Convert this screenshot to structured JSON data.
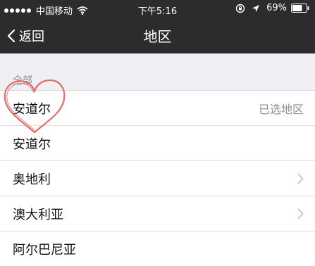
{
  "status_bar": {
    "carrier": "中国移动",
    "time": "下午5:16",
    "battery": "69%",
    "icons": [
      "signal-dots",
      "wifi-icon",
      "lock-rotation-icon",
      "location-arrow-icon",
      "battery-icon"
    ]
  },
  "nav": {
    "back_label": "返回",
    "title": "地区"
  },
  "section": {
    "header": "全部"
  },
  "regions": [
    {
      "label": "安道尔",
      "detail": "已选地区",
      "chevron": false
    },
    {
      "label": "安道尔",
      "detail": "",
      "chevron": false
    },
    {
      "label": "奥地利",
      "detail": "",
      "chevron": true
    },
    {
      "label": "澳大利亚",
      "detail": "",
      "chevron": true
    },
    {
      "label": "阿尔巴尼亚",
      "detail": "",
      "chevron": false
    }
  ],
  "colors": {
    "bar_background": "#2c2c2e",
    "page_background": "#efeff4",
    "doodle": "#e06b6b"
  }
}
